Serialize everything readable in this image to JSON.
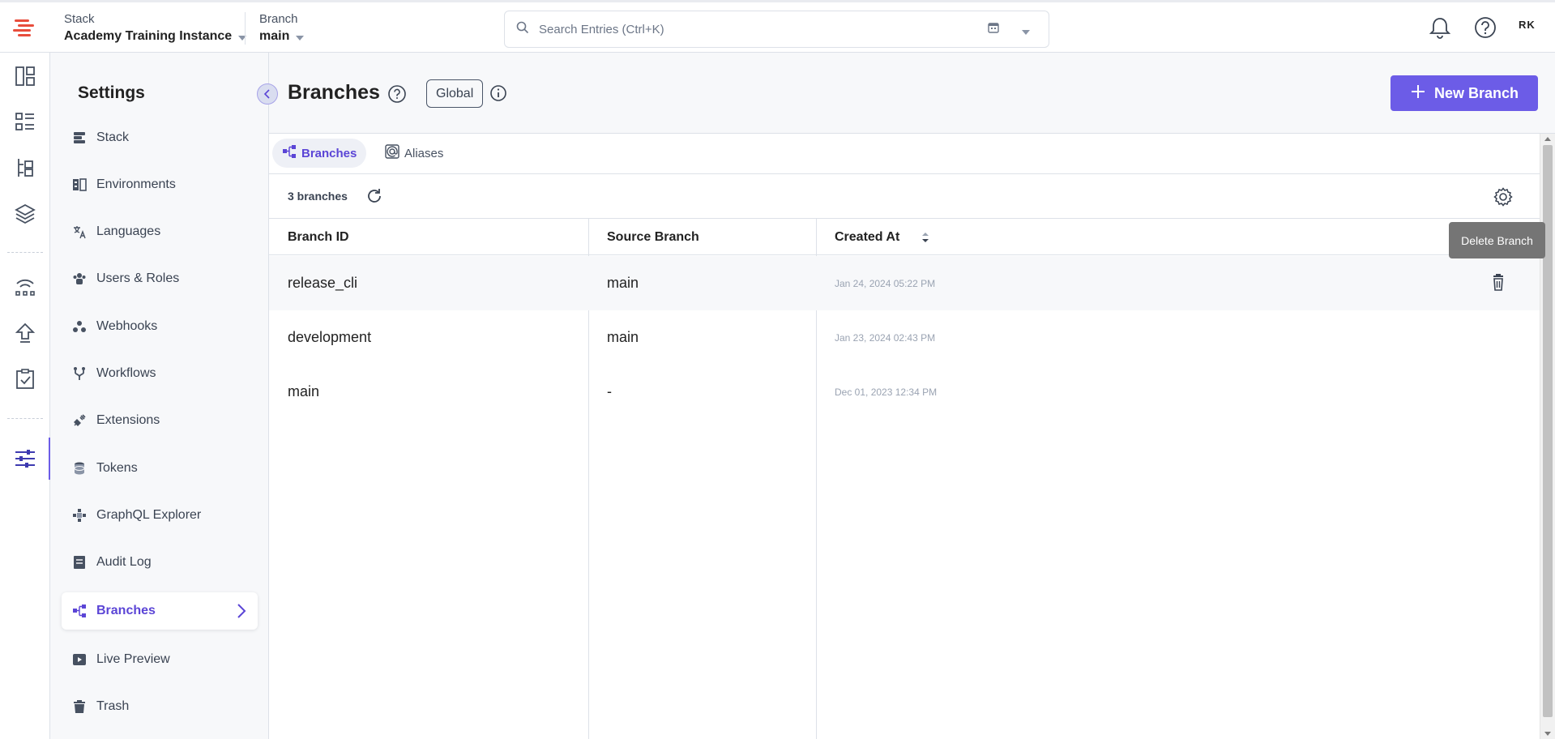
{
  "header": {
    "stack_label": "Stack",
    "stack_value": "Academy Training Instance",
    "branch_label": "Branch",
    "branch_value": "main",
    "search_placeholder": "Search Entries (Ctrl+K)",
    "avatar_initials": "RK"
  },
  "sidebar": {
    "title": "Settings",
    "items": [
      {
        "label": "Stack",
        "icon": "stack-icon"
      },
      {
        "label": "Environments",
        "icon": "environments-icon"
      },
      {
        "label": "Languages",
        "icon": "languages-icon"
      },
      {
        "label": "Users & Roles",
        "icon": "users-icon"
      },
      {
        "label": "Webhooks",
        "icon": "webhooks-icon"
      },
      {
        "label": "Workflows",
        "icon": "workflows-icon"
      },
      {
        "label": "Extensions",
        "icon": "extensions-icon"
      },
      {
        "label": "Tokens",
        "icon": "tokens-icon"
      },
      {
        "label": "GraphQL Explorer",
        "icon": "graphql-icon"
      },
      {
        "label": "Audit Log",
        "icon": "audit-log-icon"
      },
      {
        "label": "Branches",
        "icon": "branches-icon",
        "active": true
      },
      {
        "label": "Live Preview",
        "icon": "live-preview-icon"
      },
      {
        "label": "Trash",
        "icon": "trash-icon"
      }
    ]
  },
  "page": {
    "title": "Branches",
    "scope_tag": "Global",
    "new_button": "New Branch",
    "tabs": [
      {
        "label": "Branches",
        "active": true
      },
      {
        "label": "Aliases",
        "active": false
      }
    ],
    "count_text": "3 branches"
  },
  "table": {
    "columns": [
      "Branch ID",
      "Source Branch",
      "Created At"
    ],
    "rows": [
      {
        "id": "release_cli",
        "source": "main",
        "created": "Jan 24, 2024 05:22 PM"
      },
      {
        "id": "development",
        "source": "main",
        "created": "Jan 23, 2024 02:43 PM"
      },
      {
        "id": "main",
        "source": "-",
        "created": "Dec 01, 2023 12:34 PM"
      }
    ]
  },
  "tooltip": {
    "text": "Delete Branch"
  },
  "colors": {
    "accent": "#6c5ce7",
    "brand_red": "#e84d3c"
  }
}
